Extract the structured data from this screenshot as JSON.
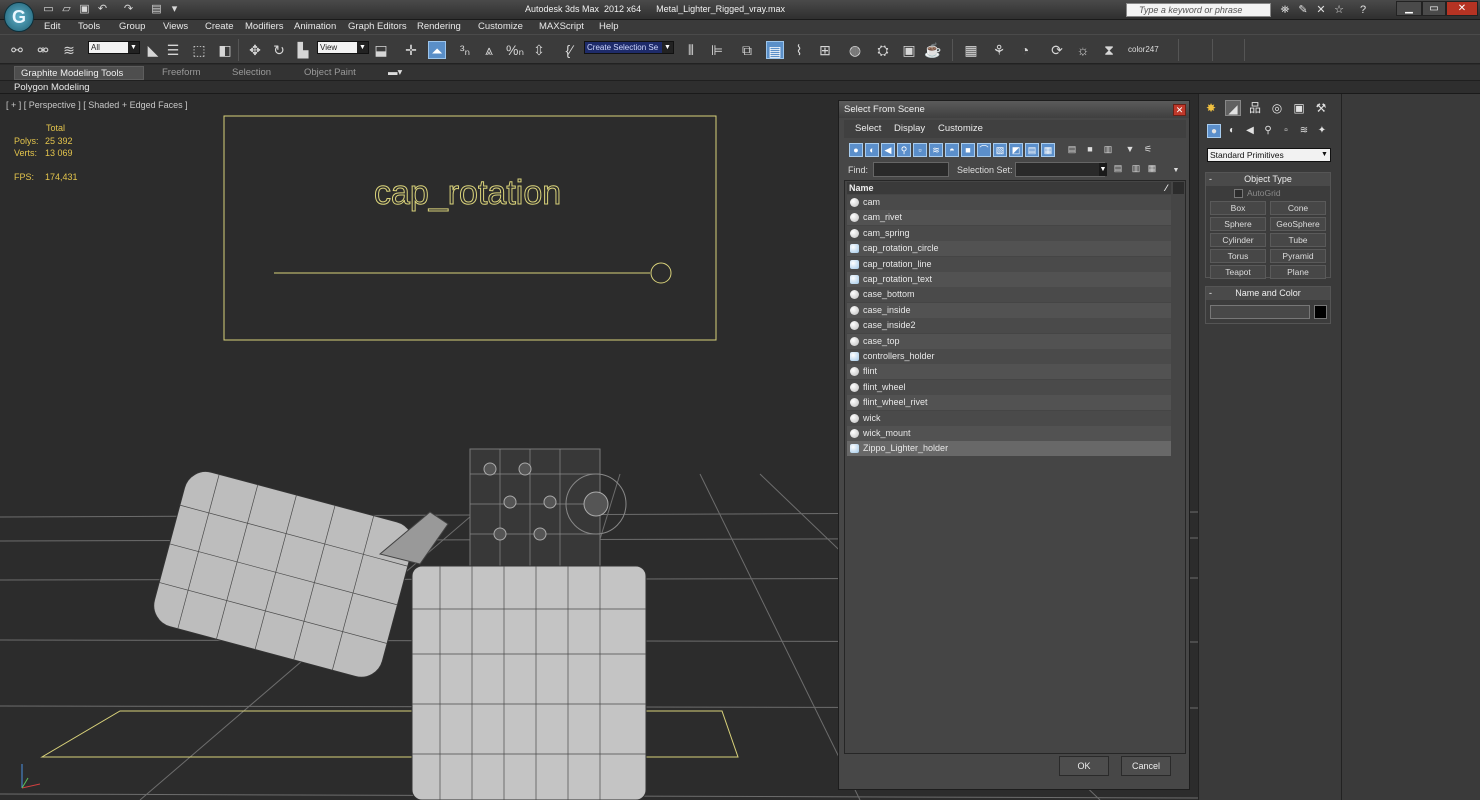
{
  "titlebar": {
    "title": "Autodesk 3ds Max  2012 x64      Metal_Lighter_Rigged_vray.max",
    "search_placeholder": "Type a keyword or phrase",
    "app_logo": "3ds-max-logo"
  },
  "menu": [
    "Edit",
    "Tools",
    "Group",
    "Views",
    "Create",
    "Modifiers",
    "Animation",
    "Graph Editors",
    "Rendering",
    "Customize",
    "MAXScript",
    "Help"
  ],
  "toolbar": {
    "filter_value": "All",
    "refcoord_value": "View",
    "selection_set_value": "Create Selection Se",
    "color_label": "color247"
  },
  "ribbon": {
    "tabs": [
      "Graphite Modeling Tools",
      "Freeform",
      "Selection",
      "Object Paint"
    ],
    "sub_label": "Polygon Modeling"
  },
  "viewport": {
    "label": "[ + ] [ Perspective ] [ Shaded + Edged Faces ]",
    "stats": {
      "total_label": "Total",
      "polys_label": "Polys:",
      "polys_value": "25 392",
      "verts_label": "Verts:",
      "verts_value": "13 069",
      "fps_label": "FPS:",
      "fps_value": "174,431"
    },
    "controller_text": "cap_rotation"
  },
  "dialog": {
    "title": "Select From Scene",
    "menu": [
      "Select",
      "Display",
      "Customize"
    ],
    "find_label": "Find:",
    "selection_set_label": "Selection Set:",
    "list_header": "Name",
    "objects": [
      {
        "name": "cam",
        "type": "geometry"
      },
      {
        "name": "cam_rivet",
        "type": "geometry"
      },
      {
        "name": "cam_spring",
        "type": "geometry"
      },
      {
        "name": "cap_rotation_circle",
        "type": "shape"
      },
      {
        "name": "cap_rotation_line",
        "type": "shape"
      },
      {
        "name": "cap_rotation_text",
        "type": "shape"
      },
      {
        "name": "case_bottom",
        "type": "geometry"
      },
      {
        "name": "case_inside",
        "type": "geometry"
      },
      {
        "name": "case_inside2",
        "type": "geometry"
      },
      {
        "name": "case_top",
        "type": "geometry"
      },
      {
        "name": "controllers_holder",
        "type": "shape"
      },
      {
        "name": "flint",
        "type": "geometry"
      },
      {
        "name": "flint_wheel",
        "type": "geometry"
      },
      {
        "name": "flint_wheel_rivet",
        "type": "geometry"
      },
      {
        "name": "wick",
        "type": "geometry"
      },
      {
        "name": "wick_mount",
        "type": "geometry"
      },
      {
        "name": "Zippo_Lighter_holder",
        "type": "shape"
      }
    ],
    "ok_label": "OK",
    "cancel_label": "Cancel"
  },
  "command_panel": {
    "category_value": "Standard Primitives",
    "object_type_title": "Object Type",
    "autogrid_label": "AutoGrid",
    "primitives": [
      "Box",
      "Cone",
      "Sphere",
      "GeoSphere",
      "Cylinder",
      "Tube",
      "Torus",
      "Pyramid",
      "Teapot",
      "Plane"
    ],
    "name_color_title": "Name and Color"
  },
  "colors": {
    "accent": "#5b8fcb",
    "stats_yellow": "#e3c44c",
    "controller_yellow": "#d9d27a",
    "close_red": "#c0392b"
  }
}
